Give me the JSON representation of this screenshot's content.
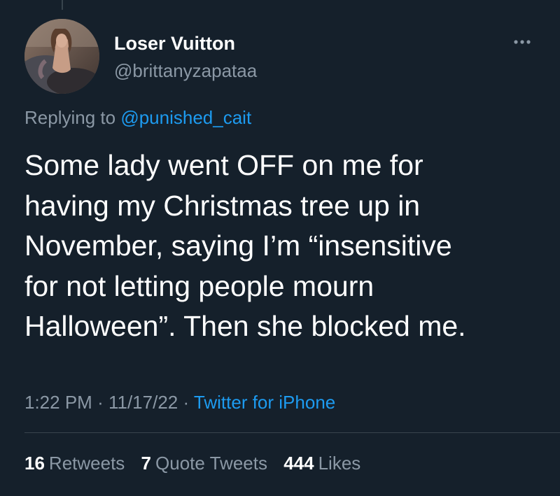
{
  "tweet": {
    "display_name": "Loser Vuitton",
    "handle": "@brittanyzapataa",
    "reply_prefix": "Replying to",
    "reply_mention": "@punished_cait",
    "text_lines": [
      "Some lady went OFF on me for",
      "having my Christmas tree up in",
      "November, saying I’m “insensitive",
      "for not letting people mourn",
      "Halloween”. Then she blocked me."
    ],
    "time": "1:22 PM",
    "date": "11/17/22",
    "separator": "·",
    "source": "Twitter for iPhone"
  },
  "stats": {
    "retweets_count": "16",
    "retweets_label": "Retweets",
    "quote_tweets_count": "7",
    "quote_tweets_label": "Quote Tweets",
    "likes_count": "444",
    "likes_label": "Likes"
  },
  "icons": {
    "more": "more-horizontal-icon"
  },
  "colors": {
    "background": "#15202b",
    "text_primary": "#ffffff",
    "text_secondary": "#8b98a5",
    "link": "#1d9bf0",
    "divider": "#38444d"
  }
}
